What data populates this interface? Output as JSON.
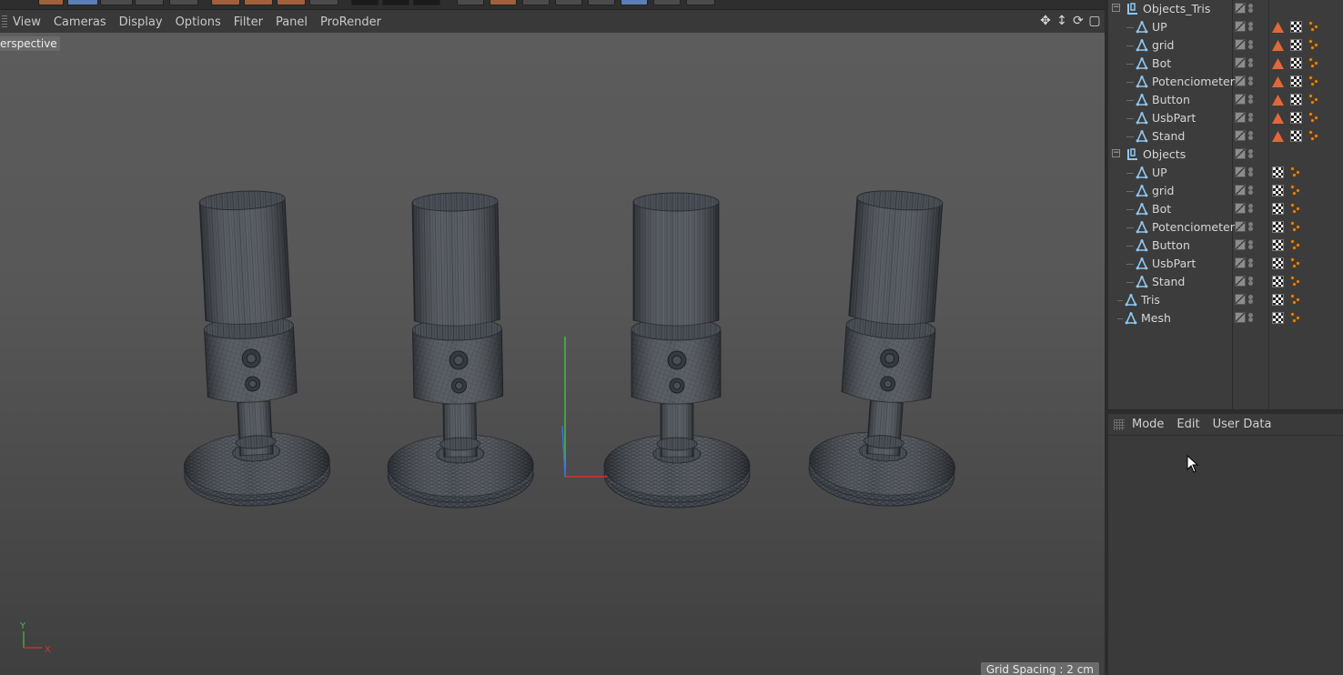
{
  "viewport": {
    "menu": [
      "View",
      "Cameras",
      "Display",
      "Options",
      "Filter",
      "Panel",
      "ProRender"
    ],
    "label": "erspective",
    "grid_spacing": "Grid Spacing : 2 cm",
    "axis_x_label": "X",
    "axis_y_label": "Y",
    "nav_icons": [
      "move-view-icon",
      "dolly-view-icon",
      "rotate-view-icon",
      "maximize-view-icon"
    ]
  },
  "object_manager": {
    "groups": [
      {
        "name": "Objects_Tris",
        "children": [
          "UP",
          "grid",
          "Bot",
          "Potenciometer",
          "Button",
          "UsbPart",
          "Stand"
        ],
        "child_tags": [
          "phong-triangle-tag",
          "material-checker-tag",
          "nodes-tag"
        ]
      },
      {
        "name": "Objects",
        "children": [
          "UP",
          "grid",
          "Bot",
          "Potenciometer",
          "Button",
          "UsbPart",
          "Stand"
        ],
        "child_tags": [
          "material-checker-tag",
          "nodes-tag"
        ]
      }
    ],
    "root_objects": [
      {
        "name": "Tris",
        "tags": [
          "material-checker-tag",
          "nodes-tag"
        ]
      },
      {
        "name": "Mesh",
        "tags": [
          "material-checker-tag",
          "nodes-tag"
        ]
      }
    ]
  },
  "attributes": {
    "menu": [
      "Mode",
      "Edit",
      "User Data"
    ]
  },
  "colors": {
    "viewport_top": "#5c5c5c",
    "viewport_bottom": "#3f3f3f",
    "panel_bg": "#3c3c3c",
    "object_icon": "#8fc6f0",
    "phong_tag": "#e0683a",
    "axis_x": "#d8322a",
    "axis_y": "#3fbf3f",
    "axis_z": "#3a6fd8"
  }
}
